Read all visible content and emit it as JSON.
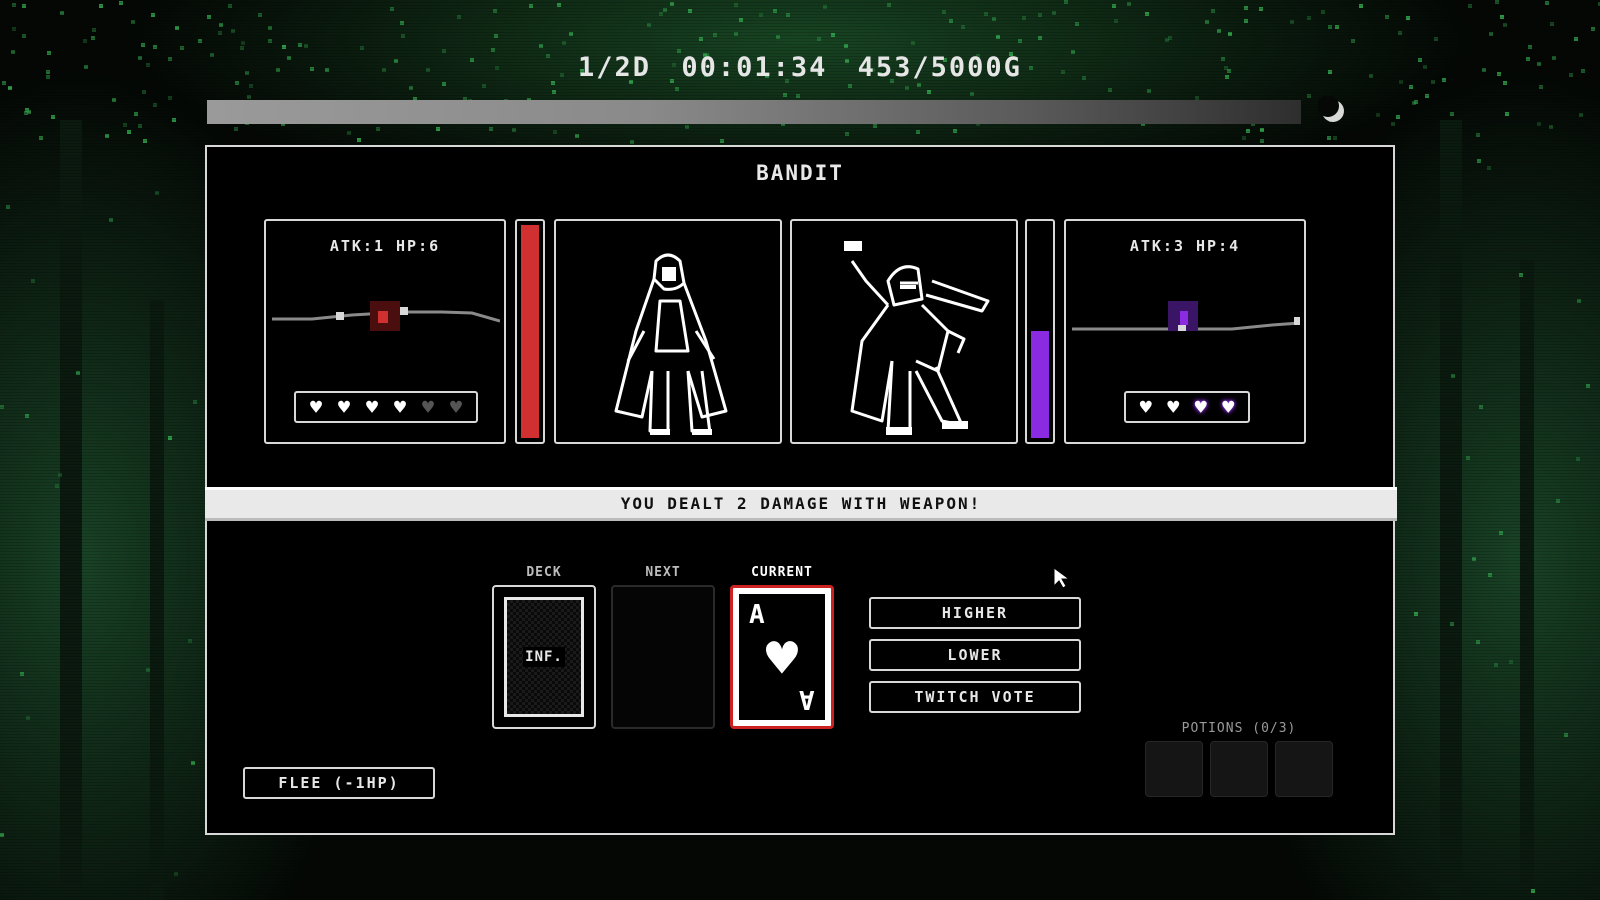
{
  "hud": {
    "day": "1/2D",
    "timer": "00:01:34",
    "gold": "453/5000G",
    "day_progress": 0.0
  },
  "enemy": {
    "name": "BANDIT"
  },
  "player": {
    "stats": "ATK:1 HP:6",
    "hearts_total": 6,
    "hearts_filled": 4,
    "hp_bar_fill": 1.0,
    "hp_bar_color": "#d03030"
  },
  "opponent": {
    "stats": "ATK:3 HP:4",
    "hearts_total": 4,
    "hearts_filled": 4,
    "hearts_highlighted": 2,
    "hp_bar_fill": 0.5,
    "hp_bar_color": "#8a2be2"
  },
  "message": "YOU DEALT 2 DAMAGE WITH WEAPON!",
  "cards": {
    "deck_label": "DECK",
    "deck_count": "INF.",
    "next_label": "NEXT",
    "current_label": "CURRENT",
    "current_rank": "A",
    "current_suit": "heart"
  },
  "actions": {
    "higher": "HIGHER",
    "lower": "LOWER",
    "twitch_vote": "TWITCH VOTE",
    "flee": "FLEE (-1HP)"
  },
  "potions": {
    "label": "POTIONS (0/3)",
    "slots": 3,
    "filled": 0
  },
  "colors": {
    "accent_red": "#d03030",
    "accent_purple": "#8a2be2",
    "ui_white": "#e8e8e8",
    "forest_green": "#2f9a48"
  }
}
